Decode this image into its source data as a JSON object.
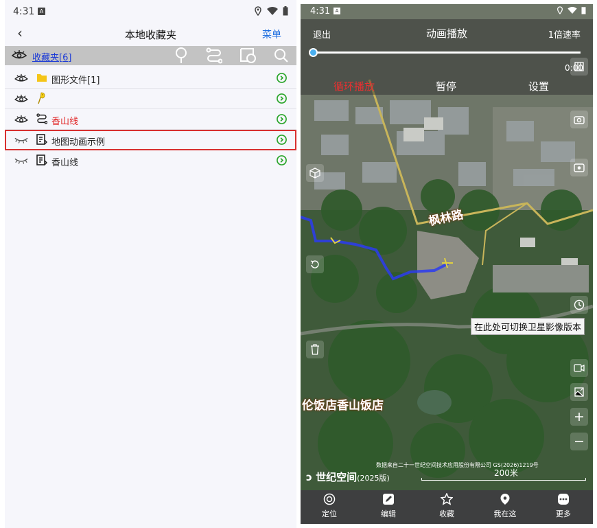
{
  "left": {
    "status": {
      "time": "4:31",
      "badge": "A"
    },
    "header": {
      "title": "本地收藏夹",
      "menu_label": "菜单",
      "back_glyph": "‹"
    },
    "toolbar": {
      "label": "收藏夹[6]"
    },
    "rows": [
      {
        "label": "图形文件[1]",
        "icon": "folder-icon",
        "visible": true,
        "color": "#222222"
      },
      {
        "label": "",
        "icon": "pin-icon",
        "visible": true,
        "color": "#222222"
      },
      {
        "label": "香山线",
        "icon": "route-icon",
        "visible": true,
        "color": "#e02020"
      },
      {
        "label": "地图动画示例",
        "icon": "animation-file-icon",
        "visible": false,
        "color": "#222222",
        "selected": true
      },
      {
        "label": "香山线",
        "icon": "animation-file-icon",
        "visible": false,
        "color": "#222222"
      }
    ]
  },
  "right": {
    "status": {
      "time": "4:31",
      "badge": "A"
    },
    "anim": {
      "exit": "退出",
      "title": "动画播放",
      "speed": "1倍速率",
      "time": "0:00",
      "loop": "循环播放",
      "pause": "暂停",
      "settings": "设置"
    },
    "map": {
      "road": "枫林路",
      "place": "伦饭店香山饭店",
      "tooltip": "在此处可切换卫星影像版本",
      "credit": "数据来自二十一世纪空间技术应用股份有限公司 GS(2026)1219号",
      "scale": "200米",
      "logo": "世纪空间",
      "logo_sub": "(2025版)"
    },
    "bottom": [
      {
        "label": "定位",
        "icon": "locate-icon"
      },
      {
        "label": "编辑",
        "icon": "edit-icon"
      },
      {
        "label": "收藏",
        "icon": "favorite-icon"
      },
      {
        "label": "我在这",
        "icon": "location-pin-icon"
      },
      {
        "label": "更多",
        "icon": "more-icon"
      }
    ]
  },
  "colors": {
    "accent": "#1f6fe0",
    "go": "#2aa52a",
    "highlight": "#d83030",
    "route": "#2c3cf0"
  }
}
